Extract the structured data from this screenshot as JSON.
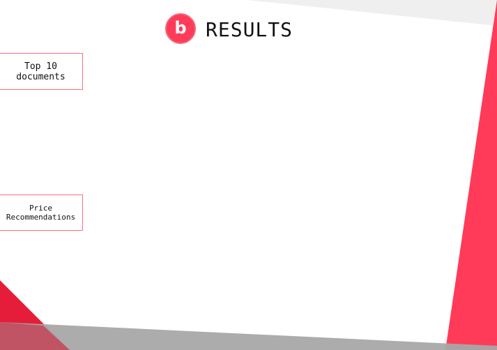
{
  "header": {
    "logo_letter": "b",
    "title": "RESULTS"
  },
  "sidebar": {
    "items": [
      {
        "label": "Top 10\ndocuments"
      },
      {
        "label": "Price\nRecommendations"
      }
    ]
  },
  "theme": {
    "accent": "#ff3b59",
    "accent_dark": "#e51d3b",
    "border": "#ff6b80",
    "gray_band": "#a8a8a8",
    "light_gray": "#f0f0f0"
  }
}
